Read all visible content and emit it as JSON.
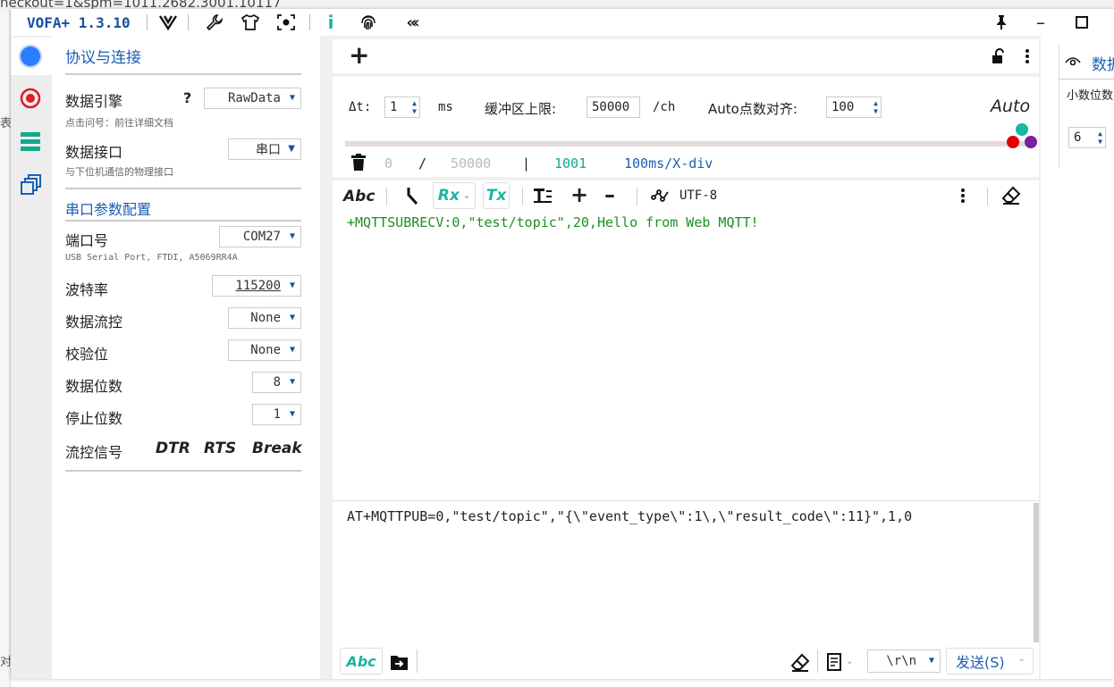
{
  "background": {
    "url_fragment": "heckout=1&spm=1011.2682.3001.10117",
    "left_chars": [
      "表",
      "对"
    ]
  },
  "titlebar": {
    "app_title": "VOFA+ 1.3.10",
    "icons": [
      "vofa-logo-icon",
      "wrench-icon",
      "tshirt-icon",
      "camera-focus-icon",
      "info-icon",
      "fingerprint-icon",
      "collapse-left-icon",
      "pin-icon",
      "minimize-icon",
      "maximize-icon"
    ]
  },
  "rail": {
    "icons": [
      "blue-dot-icon",
      "target-icon",
      "stack-icon",
      "windows-icon"
    ]
  },
  "panel": {
    "title": "协议与连接",
    "engine_label": "数据引擎",
    "engine_help": "?",
    "engine_value": "RawData",
    "engine_sub": "点击问号：前往详细文档",
    "iface_label": "数据接口",
    "iface_value": "串口",
    "iface_sub": "与下位机通信的物理接口",
    "serial_title": "串口参数配置",
    "port_label": "端口号",
    "port_value": "COM27",
    "port_desc": "USB Serial Port, FTDI, A5069RR4A",
    "baud_label": "波特率",
    "baud_value": "115200",
    "flow_label": "数据流控",
    "flow_value": "None",
    "parity_label": "校验位",
    "parity_value": "None",
    "databits_label": "数据位数",
    "databits_value": "8",
    "stopbits_label": "停止位数",
    "stopbits_value": "1",
    "signal_label": "流控信号",
    "signal_dtr": "DTR",
    "signal_rts": "RTS",
    "signal_break": "Break"
  },
  "main": {
    "add": "+",
    "dt_label": "Δt:",
    "dt_value": "1",
    "dt_unit": "ms",
    "buf_label": "缓冲区上限:",
    "buf_value": "50000",
    "buf_unit": "/ch",
    "auto_label": "Auto点数对齐:",
    "auto_value": "100",
    "auto_btn": "Auto",
    "stat_count": "0",
    "stat_slash": "/",
    "stat_max": "50000",
    "stat_bar": "|",
    "stat_1001": "1001",
    "stat_div": "100ms/X-div",
    "toolbar": {
      "abc": "Abc",
      "rx": "Rx",
      "tx": "Tx",
      "encoding": "UTF-8"
    },
    "received_text": "+MQTTSUBRECV:0,\"test/topic\",20,Hello from Web MQTT!",
    "send_text": "AT+MQTTPUB=0,\"test/topic\",\"{\\\"event_type\\\":1\\,\\\"result_code\\\":11}\",1,0",
    "bottom": {
      "abc": "Abc",
      "line_end": "\\r\\n",
      "send_btn": "发送(S)"
    }
  },
  "right_panel": {
    "title": "数据",
    "decimal_label": "小数位数",
    "decimal_value": "6"
  },
  "colors": {
    "accent": "#1a5fb4",
    "teal": "#1bb5a0",
    "green_text": "#1f8f1f",
    "dot_red": "#e00000",
    "dot_teal": "#14b8a6",
    "dot_purple": "#7a1fa0"
  }
}
